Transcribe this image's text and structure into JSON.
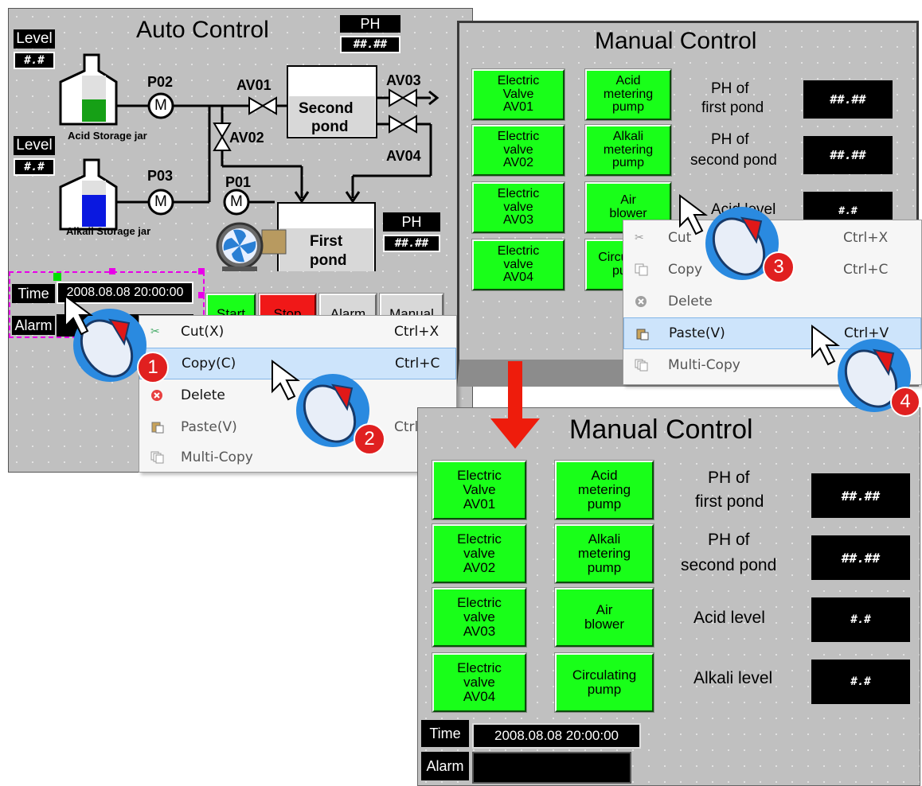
{
  "auto": {
    "title": "Auto Control",
    "ph_label_top": "PH",
    "ph_value_top": "##.##",
    "ph_label_mid": "PH",
    "ph_value_mid": "##.##",
    "level_label_1": "Level",
    "level_value_1": "#.#",
    "level_label_2": "Level",
    "level_value_2": "#.#",
    "p02": "P02",
    "p03": "P03",
    "p01": "P01",
    "av01": "AV01",
    "av02": "AV02",
    "av03": "AV03",
    "av04": "AV04",
    "motor": "M",
    "second_pond": [
      "Second",
      "pond"
    ],
    "first_pond": [
      "First",
      "pond"
    ],
    "acid_jar": "Acid Storage jar",
    "alkali_jar": "Alkali Storage jar",
    "time_label": "Time",
    "time_value": "2008.08.08 20:00:00",
    "alarm_label": "Alarm",
    "buttons": [
      "Start",
      "Stop",
      "Alarm",
      "Manual"
    ]
  },
  "manual_top": {
    "title": "Manual Control",
    "buttons_left": [
      [
        "Electric",
        "Valve",
        "AV01"
      ],
      [
        "Electric",
        "valve",
        "AV02"
      ],
      [
        "Electric",
        "valve",
        "AV03"
      ],
      [
        "Electric",
        "valve",
        "AV04"
      ]
    ],
    "buttons_right": [
      [
        "Acid",
        "metering",
        "pump"
      ],
      [
        "Alkali",
        "metering",
        "pump"
      ],
      [
        "Air",
        "blower"
      ],
      [
        "Circulating",
        "pump"
      ]
    ],
    "ph1_label": [
      "PH of",
      "first pond"
    ],
    "ph1_value": "##.##",
    "ph2_label": [
      "PH of",
      "second pond"
    ],
    "ph2_value": "##.##",
    "acid_label": "Acid level",
    "acid_value": "#.#"
  },
  "manual_bottom": {
    "title": "Manual Control",
    "buttons_left": [
      [
        "Electric",
        "Valve",
        "AV01"
      ],
      [
        "Electric",
        "valve",
        "AV02"
      ],
      [
        "Electric",
        "valve",
        "AV03"
      ],
      [
        "Electric",
        "valve",
        "AV04"
      ]
    ],
    "buttons_right": [
      [
        "Acid",
        "metering",
        "pump"
      ],
      [
        "Alkali",
        "metering",
        "pump"
      ],
      [
        "Air",
        "blower"
      ],
      [
        "Circulating",
        "pump"
      ]
    ],
    "ph1_label": [
      "PH of",
      "first pond"
    ],
    "ph1_value": "##.##",
    "ph2_label": [
      "PH of",
      "second pond"
    ],
    "ph2_value": "##.##",
    "acid_label": "Acid level",
    "acid_value": "#.#",
    "alkali_label": "Alkali level",
    "alkali_value": "#.#",
    "time_label": "Time",
    "time_value": "2008.08.08 20:00:00",
    "alarm_label": "Alarm"
  },
  "menu1": {
    "cut": "Cut(X)",
    "cut_key": "Ctrl+X",
    "copy": "Copy(C)",
    "copy_key": "Ctrl+C",
    "delete": "Delete",
    "paste": "Paste(V)",
    "paste_key": "Ctrl",
    "multicopy": "Multi-Copy"
  },
  "menu2": {
    "cut": "Cut",
    "cut_key": "Ctrl+X",
    "copy": "Copy",
    "copy_key": "Ctrl+C",
    "delete": "Delete",
    "paste": "Paste(V)",
    "paste_key": "Ctrl+V",
    "multicopy": "Multi-Copy"
  },
  "steps": [
    "1",
    "2",
    "3",
    "4"
  ],
  "colors": {
    "button_green": "#19ff19",
    "step_red": "#e02020",
    "step_ring": "#2a8ae0",
    "arrow_red": "#ee1c0c",
    "selection_blue": "#cde4fb"
  }
}
